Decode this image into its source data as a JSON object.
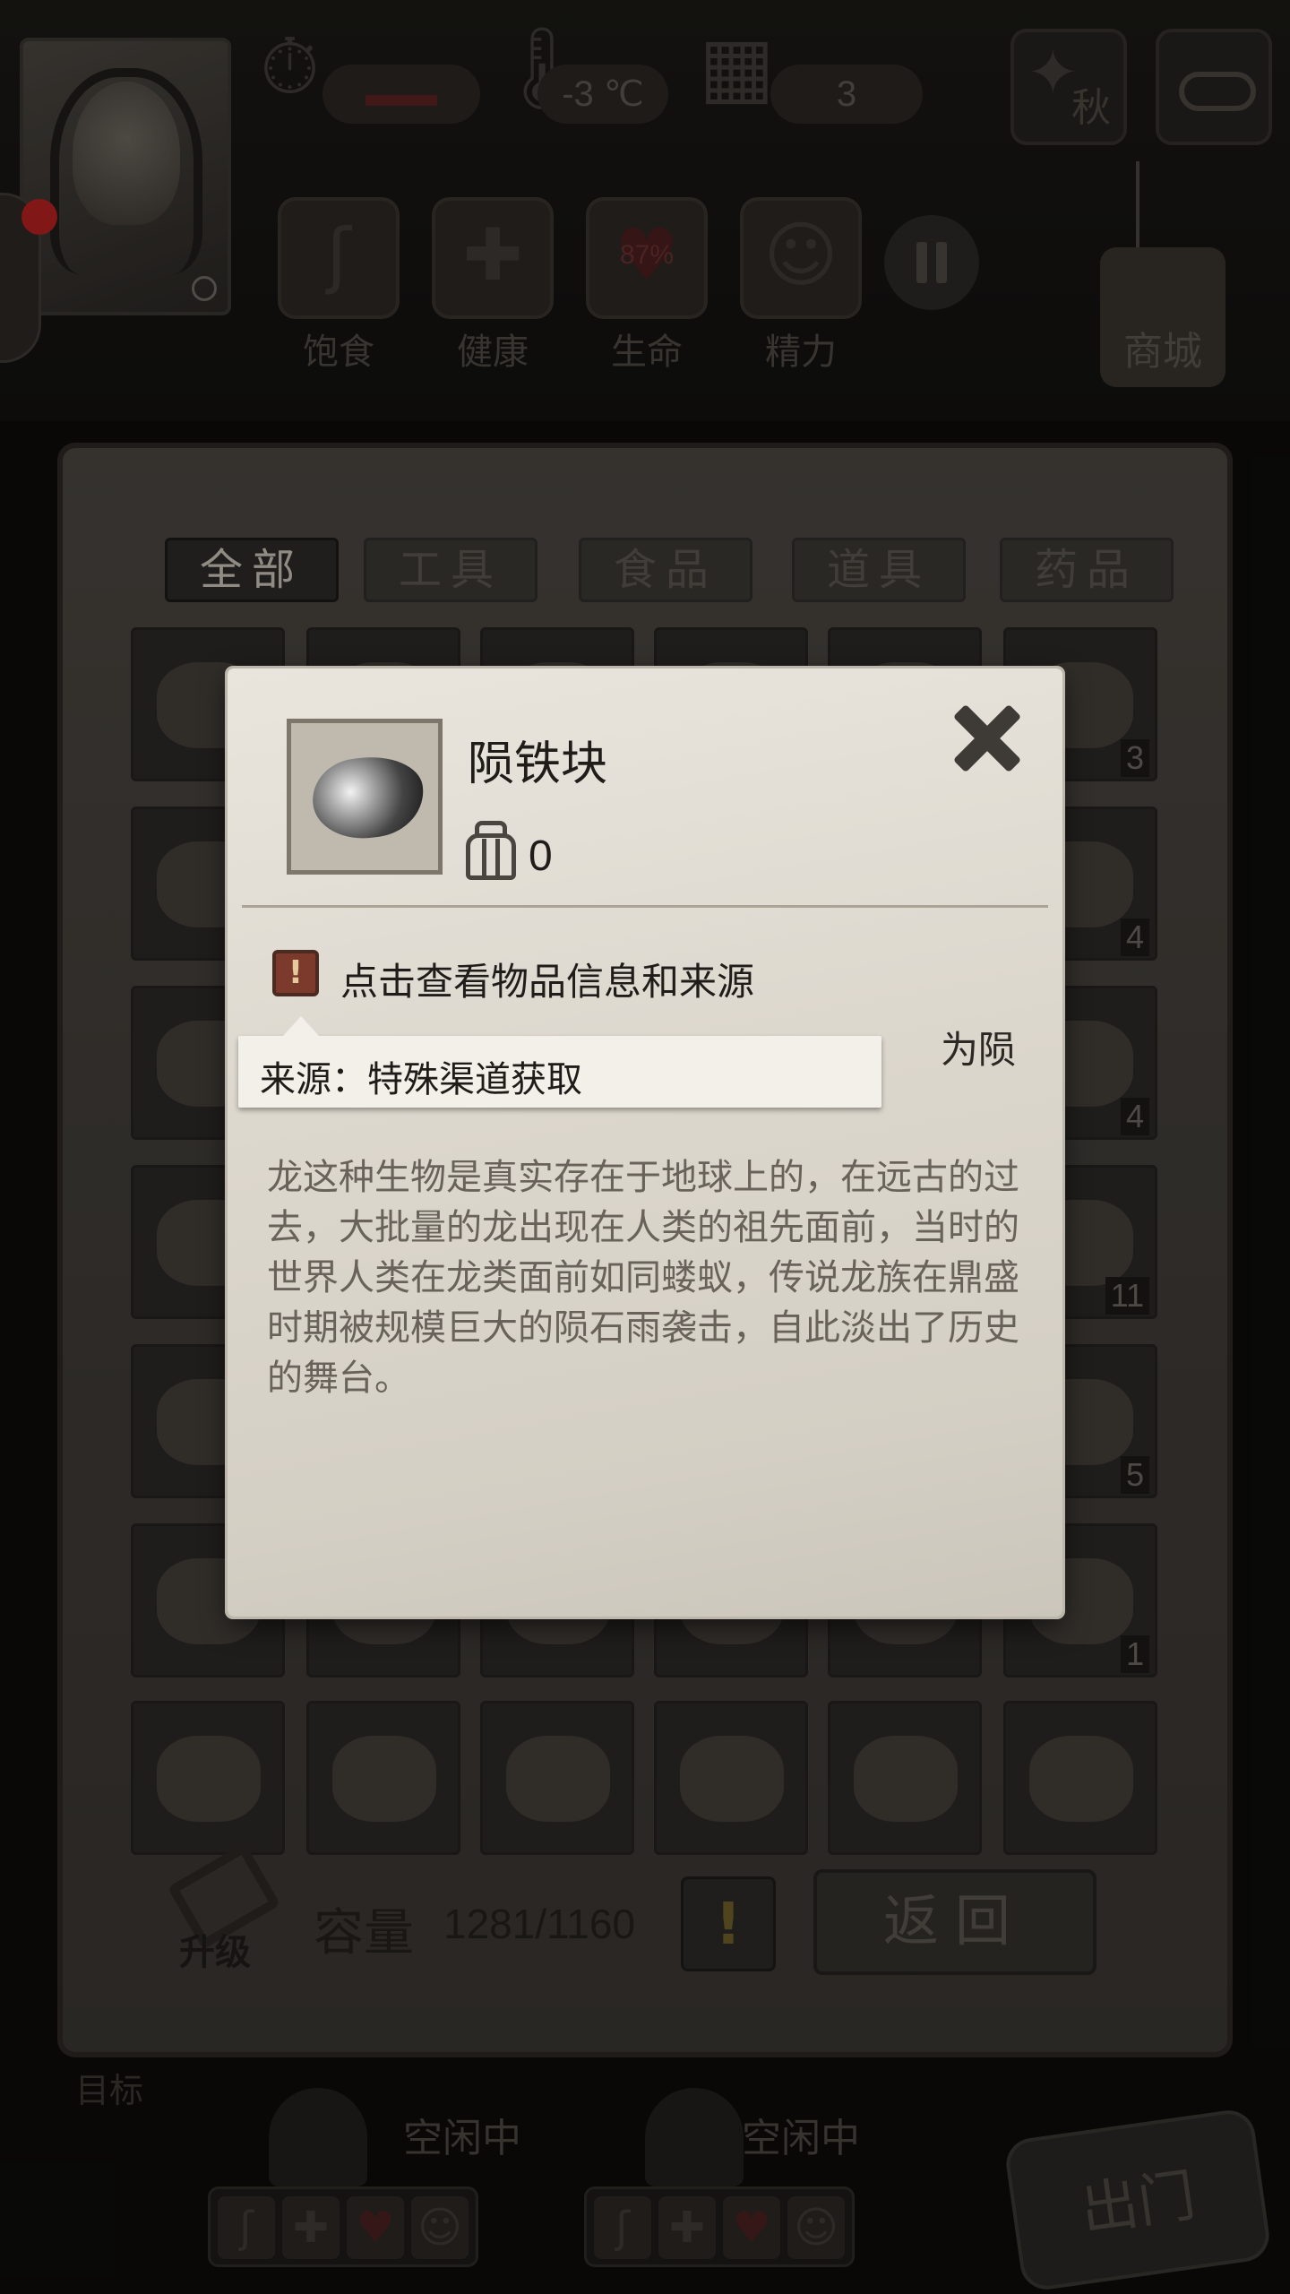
{
  "hud": {
    "temperature": "-3 ℃",
    "day_count": "3",
    "season_label": "秋",
    "shop_label": "商城",
    "vitals": [
      {
        "label": "饱食",
        "icon": "stomach-icon"
      },
      {
        "label": "健康",
        "icon": "plus-icon"
      },
      {
        "label": "生命",
        "icon": "heart-icon",
        "value": "87%"
      },
      {
        "label": "精力",
        "icon": "person-icon"
      }
    ]
  },
  "inventory": {
    "tabs": [
      "全部",
      "工具",
      "食品",
      "道具",
      "药品"
    ],
    "active_tab": "全部",
    "slot_counts": {
      "r0c5": "3",
      "r1c5": "4",
      "r2c5": "4",
      "r3c5": "11",
      "r4c5": "5",
      "r5c5": "1"
    },
    "upgrade_label": "升级",
    "capacity_label": "容量",
    "capacity_value": "1281/1160",
    "warning_glyph": "!",
    "back_label": "返回"
  },
  "item_detail": {
    "name": "陨铁块",
    "owned": "0",
    "info_hint": "点击查看物品信息和来源",
    "description_tail": "为陨",
    "lore": "龙这种生物是真实存在于地球上的，在远古的过去，大批量的龙出现在人类的祖先面前，当时的世界人类在龙类面前如同蝼蚁，传说龙族在鼎盛时期被规模巨大的陨石雨袭击，自此淡出了历史的舞台。",
    "source_tooltip": "来源：特殊渠道获取"
  },
  "workers": [
    {
      "status": "空闲中"
    },
    {
      "status": "空闲中"
    }
  ],
  "exit_label": "出门",
  "colors": {
    "panel": "#dcd7cd",
    "info_icon": "#7b3a2c",
    "background": "#0d0c0b"
  }
}
